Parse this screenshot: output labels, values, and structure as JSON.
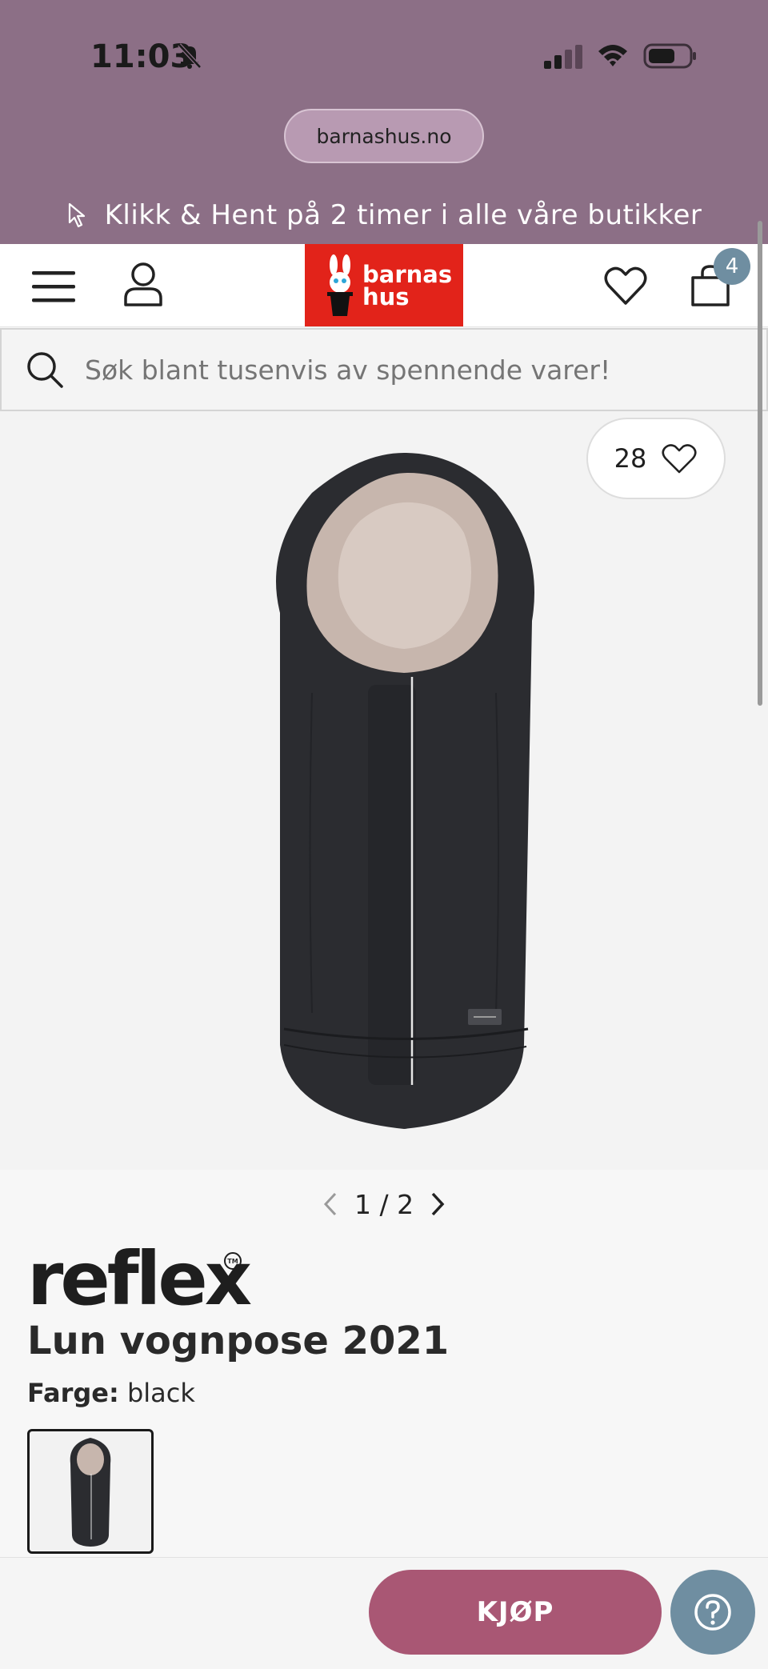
{
  "status": {
    "time": "11:03"
  },
  "browser": {
    "url": "barnashus.no"
  },
  "promo": {
    "text": "Klikk & Hent på 2 timer i alle våre butikker"
  },
  "header": {
    "logo_line1": "barnas",
    "logo_line2": "hus",
    "cart_count": "4"
  },
  "search": {
    "placeholder": "Søk blant tusenvis av spennende varer!"
  },
  "gallery": {
    "likes": "28",
    "current": "1",
    "separator": "/",
    "total": "2"
  },
  "product": {
    "brand": "reflex",
    "brand_mark": "TM",
    "title": "Lun vognpose 2021",
    "color_label": "Farge:",
    "color_value": "black"
  },
  "actions": {
    "buy_label": "KJØP"
  },
  "colors": {
    "status_bg": "#8c6f86",
    "logo_red": "#e2231a",
    "buy_button": "#a95774",
    "badge": "#6f8ea1"
  }
}
